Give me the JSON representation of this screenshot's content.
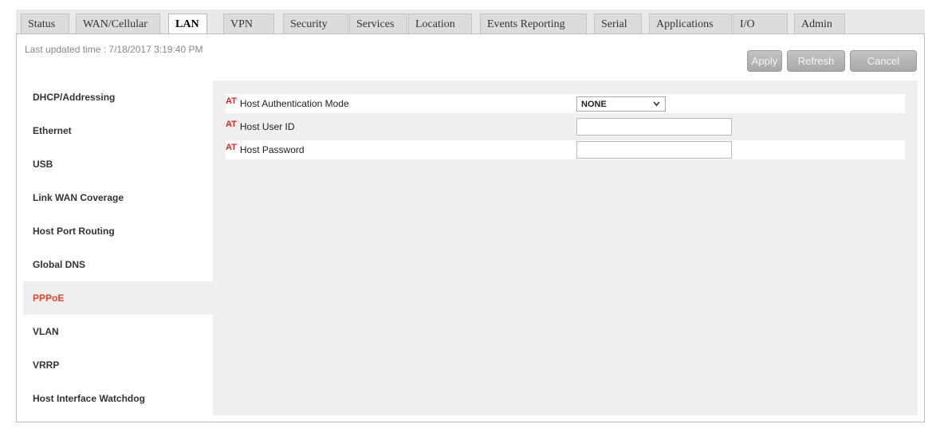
{
  "tabs": [
    {
      "label": "Status"
    },
    {
      "label": "WAN/Cellular"
    },
    {
      "label": "LAN"
    },
    {
      "label": "VPN"
    },
    {
      "label": "Security"
    },
    {
      "label": "Services"
    },
    {
      "label": "Location"
    },
    {
      "label": "Events Reporting"
    },
    {
      "label": "Serial"
    },
    {
      "label": "Applications"
    },
    {
      "label": "I/O"
    },
    {
      "label": "Admin"
    }
  ],
  "active_tab": "LAN",
  "header": {
    "last_updated": "Last updated time : 7/18/2017 3:19:40 PM",
    "apply_label": "Apply",
    "refresh_label": "Refresh",
    "cancel_label": "Cancel"
  },
  "sidebar": {
    "items": [
      {
        "label": "DHCP/Addressing"
      },
      {
        "label": "Ethernet"
      },
      {
        "label": "USB"
      },
      {
        "label": "Link WAN Coverage"
      },
      {
        "label": "Host Port Routing"
      },
      {
        "label": "Global DNS"
      },
      {
        "label": "PPPoE"
      },
      {
        "label": "VLAN"
      },
      {
        "label": "VRRP"
      },
      {
        "label": "Host Interface Watchdog"
      }
    ],
    "active": "PPPoE"
  },
  "form": {
    "at_marker": "AT",
    "auth_mode_label": "Host Authentication Mode",
    "auth_mode_value": "NONE",
    "user_id_label": "Host User ID",
    "user_id_value": "",
    "password_label": "Host Password",
    "password_value": ""
  },
  "colors": {
    "accent": "#e8432b",
    "at_marker": "#e02020",
    "button": "#b4b4b4",
    "content_bg": "#efefef"
  },
  "icons": {
    "select_arrow": "chevron-down-icon"
  }
}
